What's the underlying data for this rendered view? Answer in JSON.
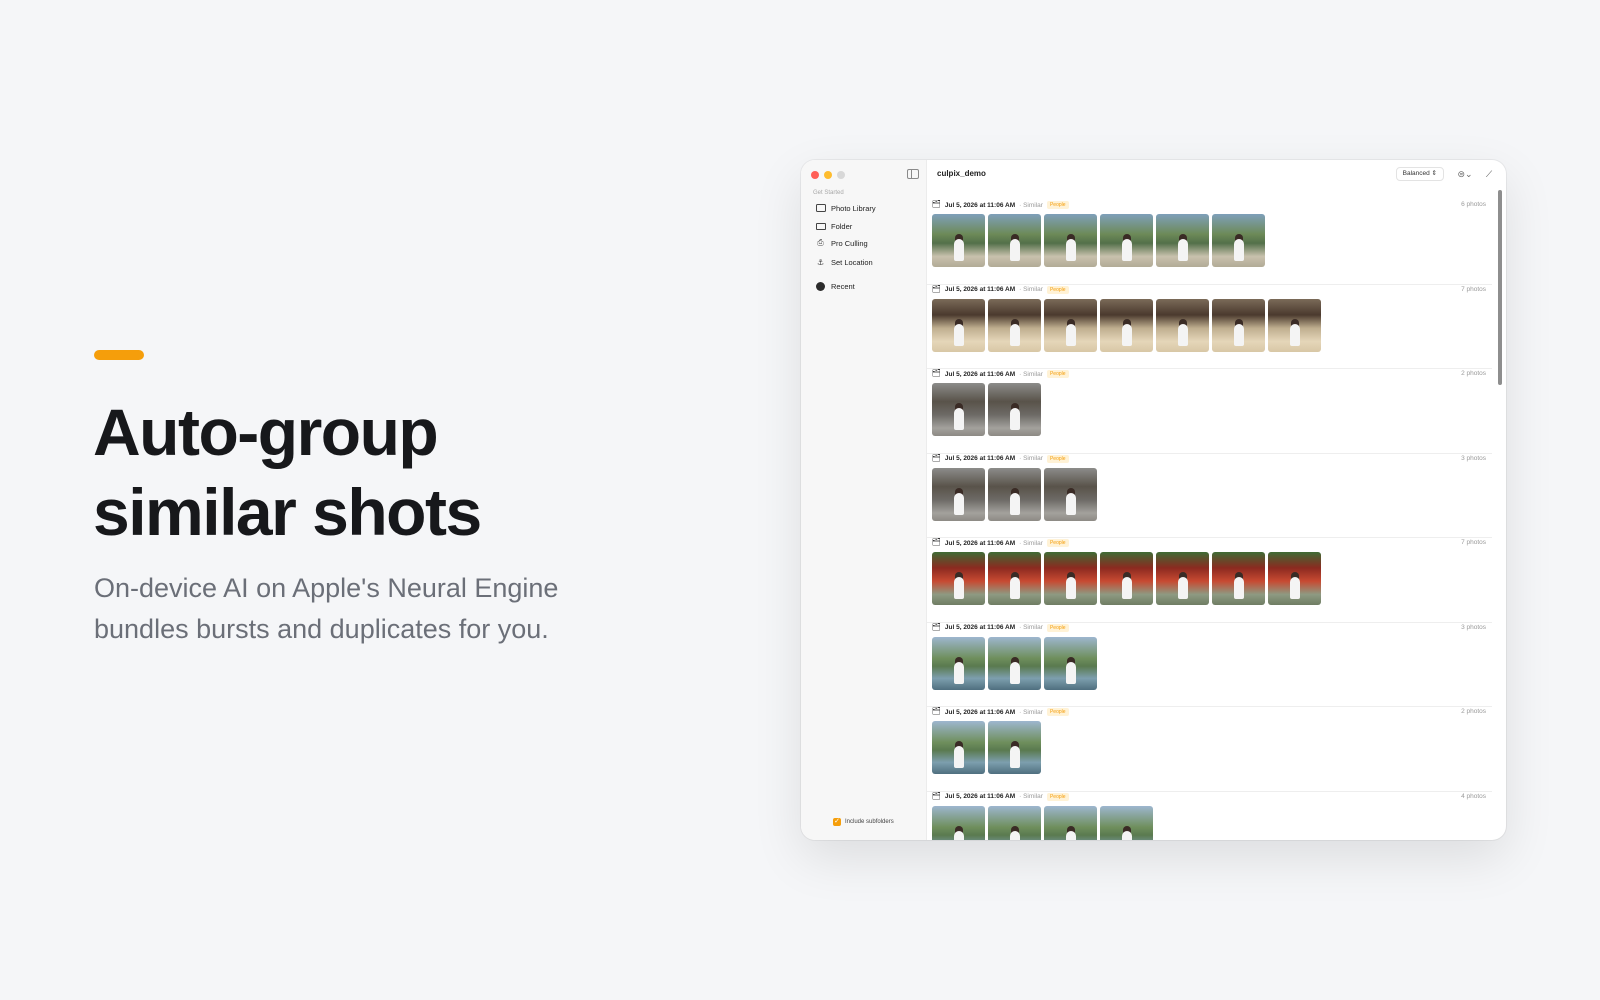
{
  "hero": {
    "headline_line1": "Auto-group",
    "headline_line2": "similar shots",
    "subtitle_line1": "On-device AI on Apple's Neural Engine",
    "subtitle_line2": "bundles bursts and duplicates for you.",
    "accent_color": "#f59e0b"
  },
  "app": {
    "title": "culpix_demo",
    "mode": "Balanced ⇕",
    "filter_icon": "filter-icon",
    "wand_icon": "wand-icon"
  },
  "sidebar": {
    "section_label": "Get Started",
    "items": [
      {
        "label": "Photo Library",
        "icon": "photos-icon"
      },
      {
        "label": "Folder",
        "icon": "folder-icon"
      },
      {
        "label": "Pro Culling",
        "icon": "camera-icon"
      },
      {
        "label": "Set Location",
        "icon": "location-icon"
      },
      {
        "label": "Recent",
        "icon": "recent-icon"
      }
    ],
    "include_subfolders": "Include subfolders",
    "include_subfolders_checked": true
  },
  "groups": [
    {
      "date": "Jul 5, 2026 at 11:06 AM",
      "kind": "· Similar",
      "badge": "People",
      "count": "6 photos",
      "photo_count": 6,
      "palette": "park"
    },
    {
      "date": "Jul 5, 2026 at 11:06 AM",
      "kind": "· Similar",
      "badge": "People",
      "count": "7 photos",
      "photo_count": 7,
      "palette": "sand"
    },
    {
      "date": "Jul 5, 2026 at 11:06 AM",
      "kind": "· Similar",
      "badge": "People",
      "count": "2 photos",
      "photo_count": 2,
      "palette": "gray"
    },
    {
      "date": "Jul 5, 2026 at 11:06 AM",
      "kind": "· Similar",
      "badge": "People",
      "count": "3 photos",
      "photo_count": 3,
      "palette": "gray"
    },
    {
      "date": "Jul 5, 2026 at 11:06 AM",
      "kind": "· Similar",
      "badge": "People",
      "count": "7 photos",
      "photo_count": 7,
      "palette": "temple"
    },
    {
      "date": "Jul 5, 2026 at 11:06 AM",
      "kind": "· Similar",
      "badge": "People",
      "count": "3 photos",
      "photo_count": 3,
      "palette": "lake"
    },
    {
      "date": "Jul 5, 2026 at 11:06 AM",
      "kind": "· Similar",
      "badge": "People",
      "count": "2 photos",
      "photo_count": 2,
      "palette": "lake"
    },
    {
      "date": "Jul 5, 2026 at 11:06 AM",
      "kind": "· Similar",
      "badge": "People",
      "count": "4 photos",
      "photo_count": 4,
      "palette": "lake"
    }
  ]
}
